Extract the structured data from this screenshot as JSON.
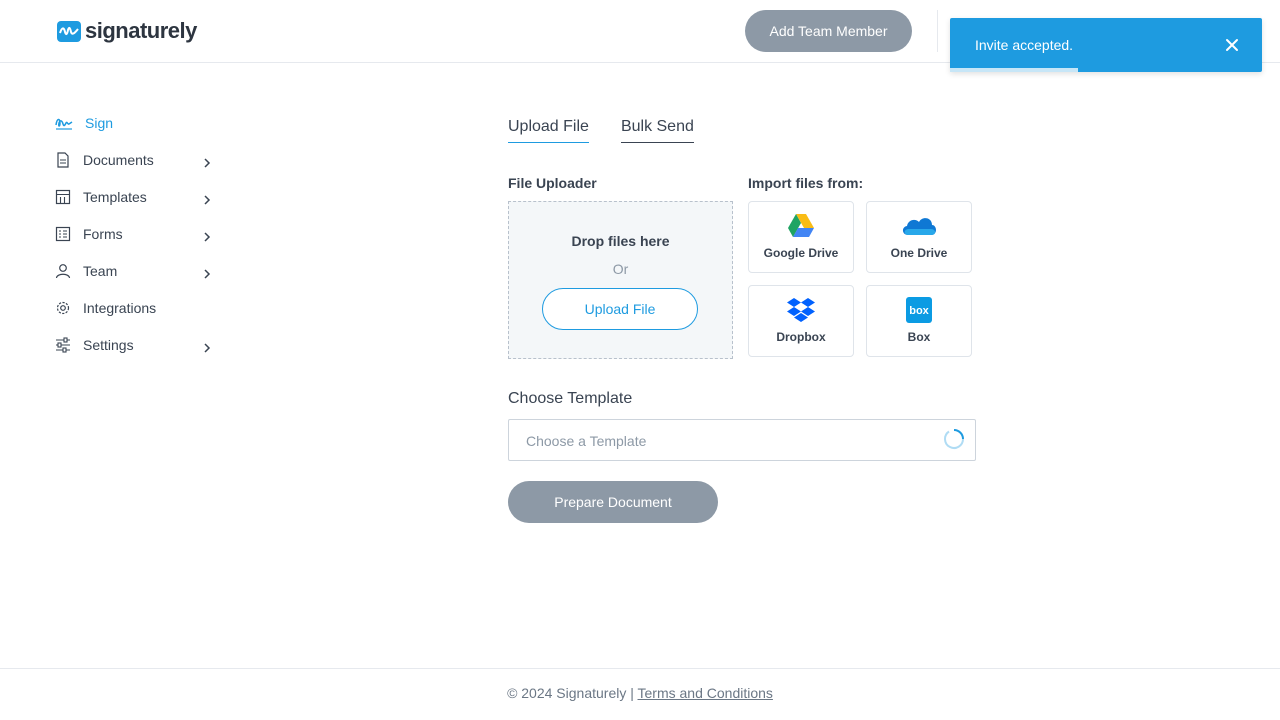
{
  "app": {
    "brand": "signaturely",
    "accent_color": "#1e9be0"
  },
  "header": {
    "add_team_member_label": "Add Team Member"
  },
  "toast": {
    "message": "Invite accepted.",
    "close_icon": "close-icon",
    "progress": 0.41
  },
  "sidebar": {
    "items": [
      {
        "label": "Sign",
        "icon": "signature-icon",
        "active": true,
        "has_submenu": false
      },
      {
        "label": "Documents",
        "icon": "document-icon",
        "active": false,
        "has_submenu": true
      },
      {
        "label": "Templates",
        "icon": "templates-icon",
        "active": false,
        "has_submenu": true
      },
      {
        "label": "Forms",
        "icon": "forms-icon",
        "active": false,
        "has_submenu": true
      },
      {
        "label": "Team",
        "icon": "user-icon",
        "active": false,
        "has_submenu": true
      },
      {
        "label": "Integrations",
        "icon": "gear-icon",
        "active": false,
        "has_submenu": false
      },
      {
        "label": "Settings",
        "icon": "sliders-icon",
        "active": false,
        "has_submenu": true
      }
    ]
  },
  "main": {
    "tabs": [
      {
        "label": "Upload File",
        "active": true
      },
      {
        "label": "Bulk Send",
        "active": false
      }
    ],
    "file_uploader": {
      "title": "File Uploader",
      "drop_text": "Drop files here",
      "or_text": "Or",
      "upload_button": "Upload File"
    },
    "import": {
      "title": "Import files from:",
      "sources": [
        {
          "label": "Google Drive",
          "icon": "google-drive-icon"
        },
        {
          "label": "One Drive",
          "icon": "onedrive-icon"
        },
        {
          "label": "Dropbox",
          "icon": "dropbox-icon"
        },
        {
          "label": "Box",
          "icon": "box-icon"
        }
      ]
    },
    "template": {
      "title": "Choose Template",
      "placeholder": "Choose a Template",
      "loading_icon": "spinner-icon"
    },
    "prepare_button": "Prepare Document"
  },
  "footer": {
    "copyright": "© 2024 Signaturely |",
    "terms_link": "Terms and Conditions"
  }
}
